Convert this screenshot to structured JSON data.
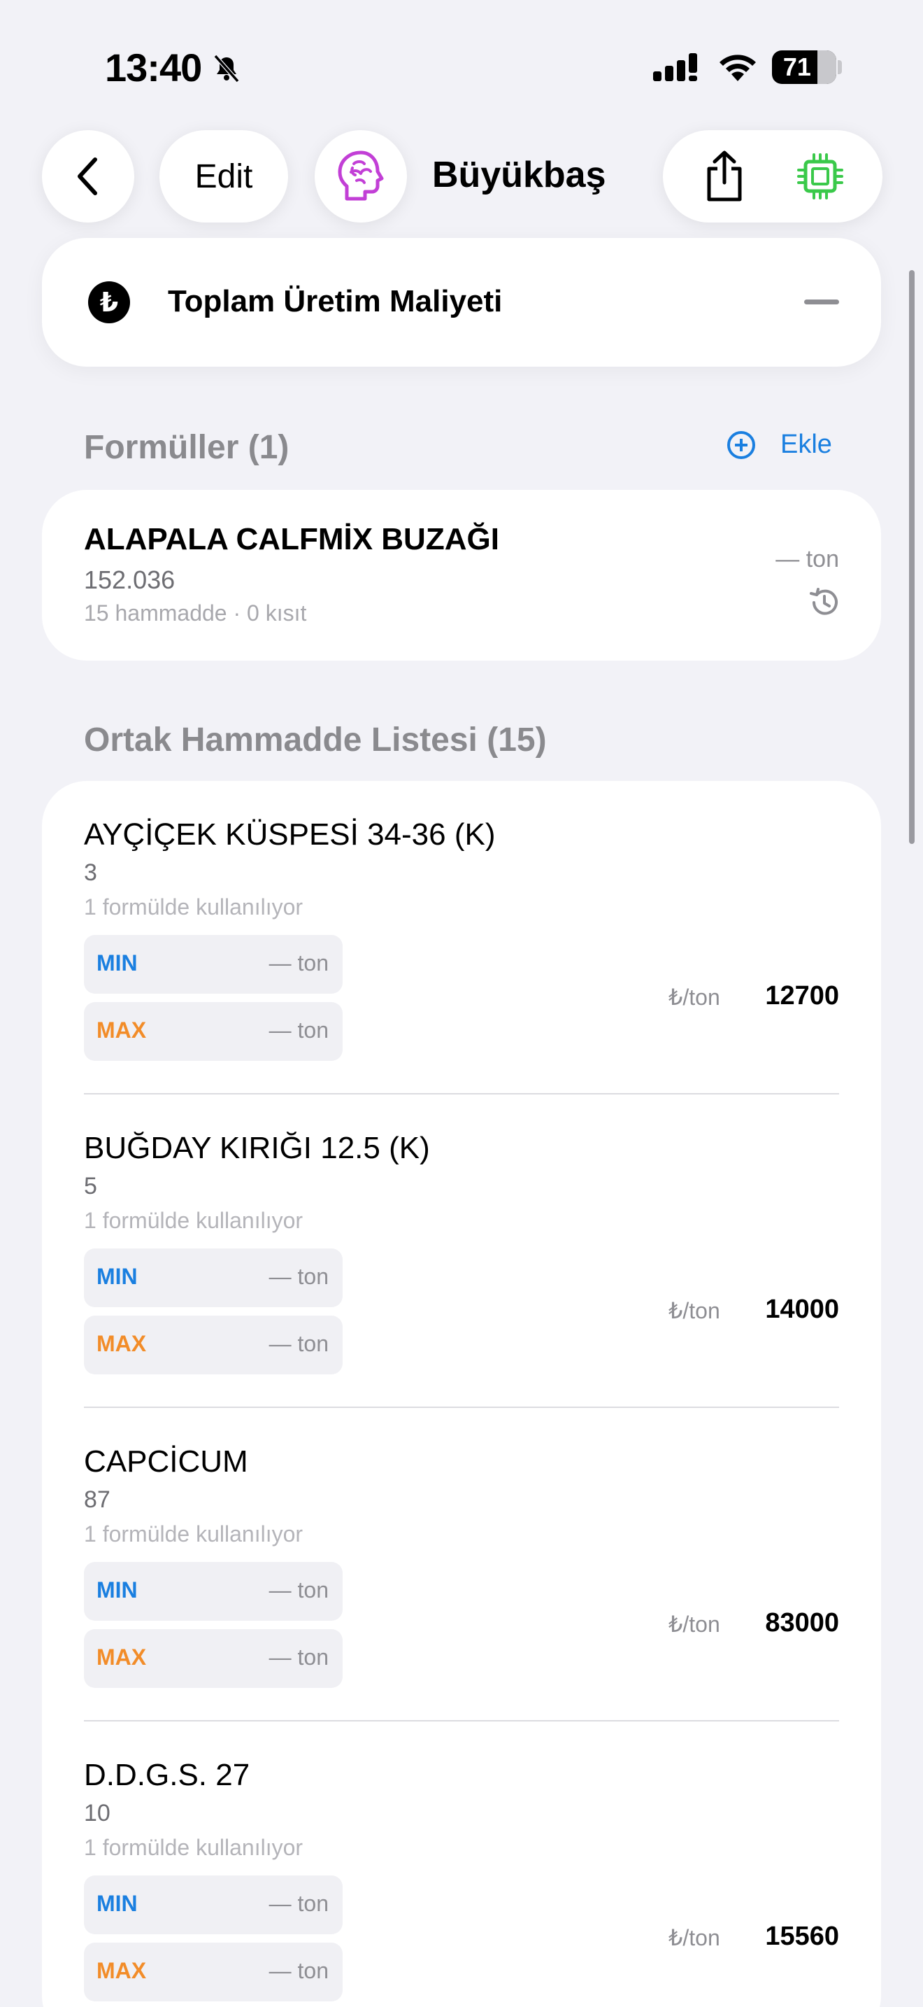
{
  "status_bar": {
    "time": "13:40",
    "battery": "71",
    "battery_level_percent": 71
  },
  "nav": {
    "edit_label": "Edit",
    "title": "Büyükbaş",
    "icons": [
      "chevron-left-icon",
      "brain-icon",
      "share-icon",
      "chip-icon"
    ]
  },
  "cost_card": {
    "currency_symbol": "₺",
    "title": "Toplam Üretim Maliyeti"
  },
  "formulas": {
    "header": "Formüller (1)",
    "add_label": "Ekle",
    "items": [
      {
        "name": "ALAPALA CALFMİX BUZAĞI",
        "value": "152.036",
        "meta": "15 hammadde · 0 kısıt",
        "amount": "— ton"
      }
    ]
  },
  "ingredients": {
    "header": "Ortak Hammadde Listesi (15)",
    "items": [
      {
        "name": "AYÇİÇEK KÜSPESİ 34-36 (K)",
        "value": "3",
        "usage": "1 formülde kullanılıyor",
        "min_label": "MIN",
        "min_value": "— ton",
        "max_label": "MAX",
        "max_value": "— ton",
        "unit": "₺/ton",
        "price": "12700"
      },
      {
        "name": "BUĞDAY KIRIĞI 12.5 (K)",
        "value": "5",
        "usage": "1 formülde kullanılıyor",
        "min_label": "MIN",
        "min_value": "— ton",
        "max_label": "MAX",
        "max_value": "— ton",
        "unit": "₺/ton",
        "price": "14000"
      },
      {
        "name": "CAPCİCUM",
        "value": "87",
        "usage": "1 formülde kullanılıyor",
        "min_label": "MIN",
        "min_value": "— ton",
        "max_label": "MAX",
        "max_value": "— ton",
        "unit": "₺/ton",
        "price": "83000"
      },
      {
        "name": "D.D.G.S. 27",
        "value": "10",
        "usage": "1 formülde kullanılıyor",
        "min_label": "MIN",
        "min_value": "— ton",
        "max_label": "MAX",
        "max_value": "— ton",
        "unit": "₺/ton",
        "price": "15560"
      }
    ]
  },
  "colors": {
    "accent_blue": "#1a7fe0",
    "accent_orange": "#f28c28",
    "brain_purple": "#c23fd6",
    "chip_green": "#3ac94a"
  }
}
